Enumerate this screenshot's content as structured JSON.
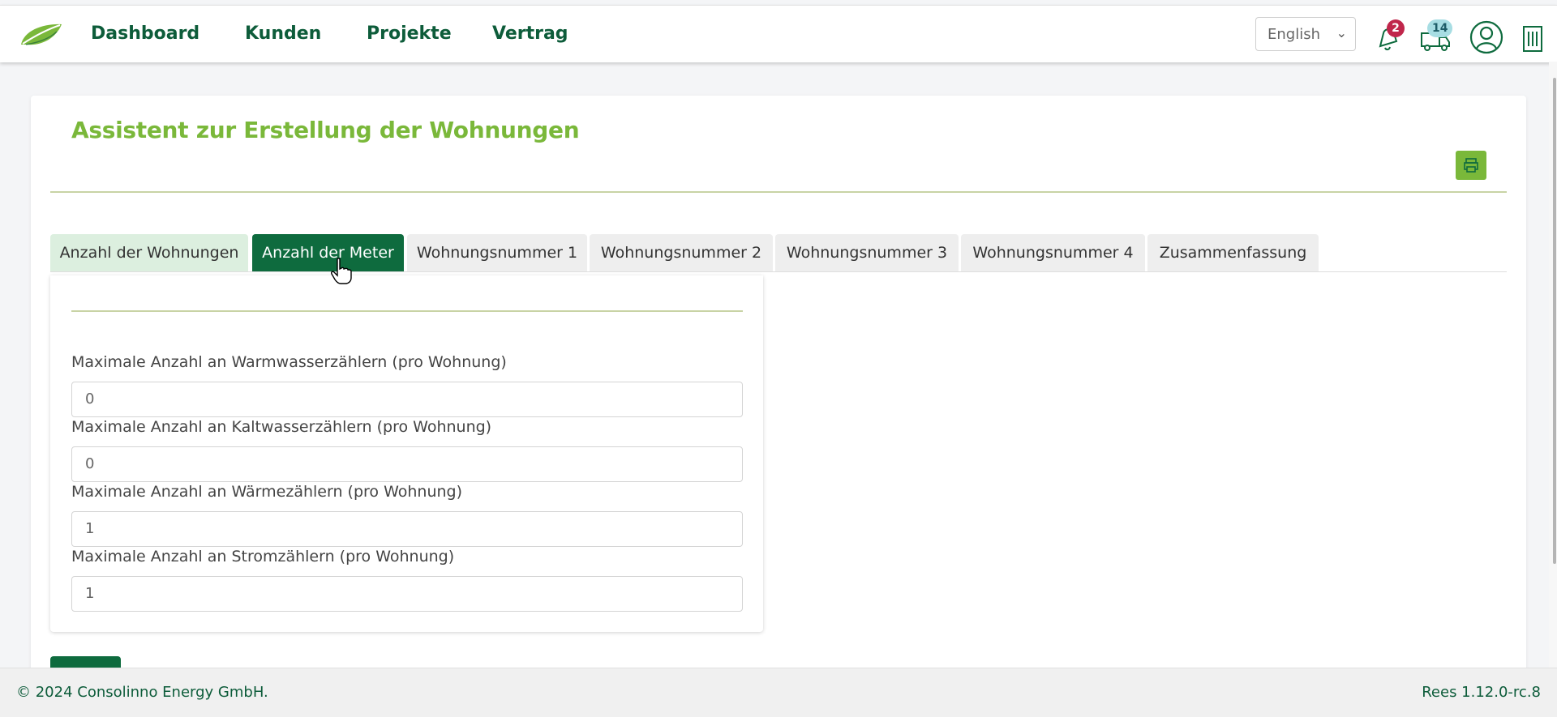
{
  "nav": {
    "items": [
      {
        "label": "Dashboard"
      },
      {
        "label": "Kunden"
      },
      {
        "label": "Projekte"
      },
      {
        "label": "Vertrag"
      }
    ],
    "language": "English",
    "notifications_count": "2",
    "messages_count": "14",
    "icons": [
      "leaf-logo",
      "bell-icon",
      "truck-icon",
      "user-icon",
      "building-icon"
    ]
  },
  "page": {
    "title": "Assistent zur Erstellung der Wohnungen",
    "print_icon": "printer-icon"
  },
  "tabs": [
    {
      "label": "Anzahl der Wohnungen",
      "state": "done"
    },
    {
      "label": "Anzahl der Meter",
      "state": "active"
    },
    {
      "label": "Wohnungsnummer 1",
      "state": "pending"
    },
    {
      "label": "Wohnungsnummer 2",
      "state": "pending"
    },
    {
      "label": "Wohnungsnummer 3",
      "state": "pending"
    },
    {
      "label": "Wohnungsnummer 4",
      "state": "pending"
    },
    {
      "label": "Zusammenfassung",
      "state": "pending"
    }
  ],
  "form": {
    "fields": [
      {
        "label": "Maximale Anzahl an Warmwasserzählern (pro Wohnung)",
        "value": "0"
      },
      {
        "label": "Maximale Anzahl an Kaltwasserzählern (pro Wohnung)",
        "value": "0"
      },
      {
        "label": "Maximale Anzahl an Wärmezählern (pro Wohnung)",
        "value": "1"
      },
      {
        "label": "Maximale Anzahl an Stromzählern (pro Wohnung)",
        "value": "1"
      }
    ]
  },
  "footer": {
    "copyright": "© 2024 Consolinno Energy GmbH.",
    "version": "Rees 1.12.0-rc.8"
  },
  "colors": {
    "brand_dark": "#0e6b3e",
    "brand_light": "#7ab83a",
    "badge_red": "#c0264b",
    "badge_teal": "#a7dde3"
  }
}
